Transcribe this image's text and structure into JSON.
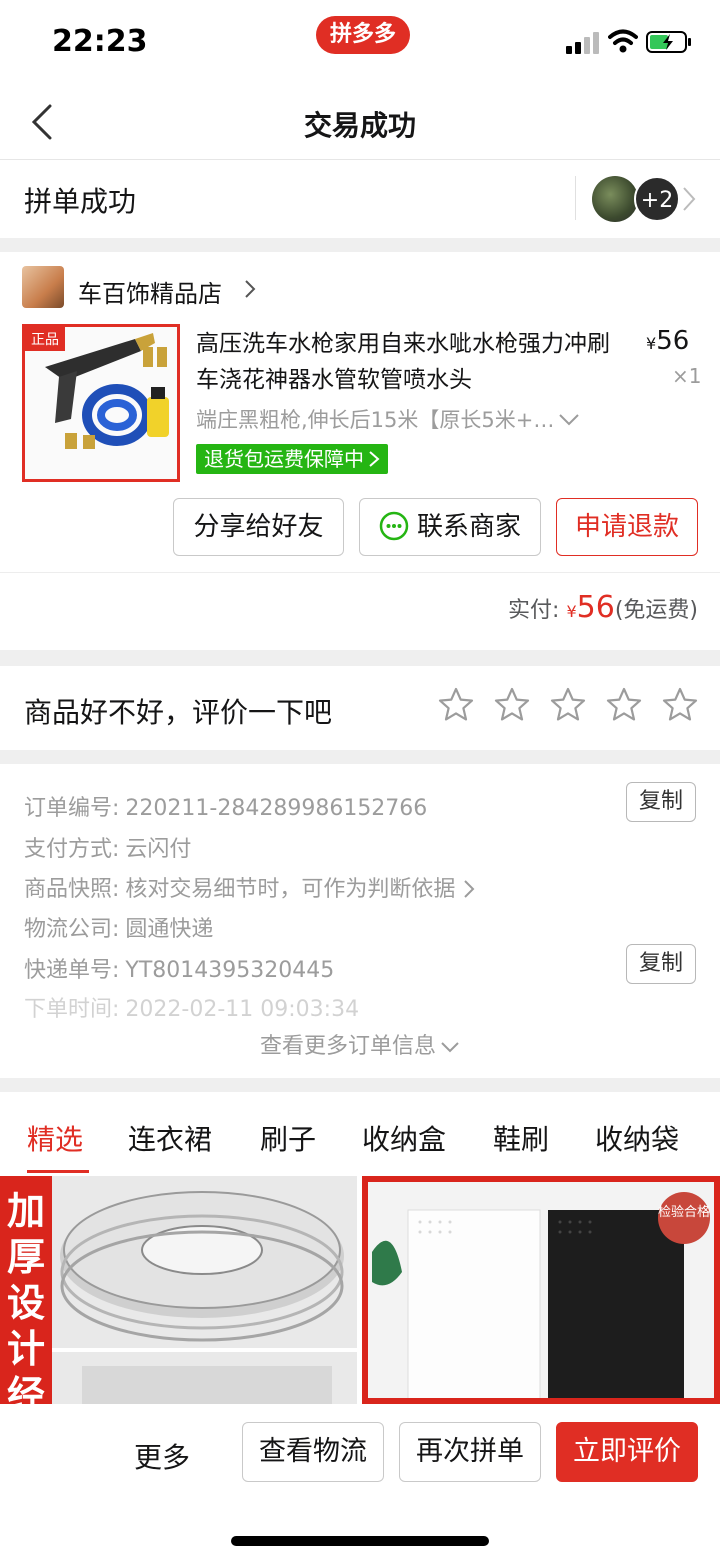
{
  "status_bar": {
    "time": "22:23",
    "brand_badge": "拼多多"
  },
  "nav": {
    "title": "交易成功"
  },
  "group": {
    "label": "拼单成功",
    "extra_count": "+2"
  },
  "shop": {
    "name": "车百饰精品店"
  },
  "product": {
    "thumb_tag": "正品",
    "title": "高压洗车水枪家用自来水呲水枪强力冲刷车浇花神器水管软管喷水头",
    "currency": "¥",
    "price": "56",
    "quantity": "×1",
    "spec": "端庄黑粗枪,伸长后15米【原长5米+…",
    "badge": "退货包运费保障中"
  },
  "actions": {
    "share": "分享给好友",
    "contact": "联系商家",
    "refund": "申请退款"
  },
  "payment": {
    "label": "实付:",
    "currency": "¥",
    "amount": "56",
    "note": "(免运费)"
  },
  "rating": {
    "prompt": "商品好不好，评价一下吧",
    "stars": 5,
    "filled": 0
  },
  "order_info": {
    "rows": [
      {
        "label": "订单编号:",
        "value": "220211-284289986152766",
        "copy": "复制"
      },
      {
        "label": "支付方式:",
        "value": "云闪付"
      },
      {
        "label": "商品快照:",
        "value": "核对交易细节时，可作为判断依据"
      },
      {
        "label": "物流公司:",
        "value": "圆通快递"
      },
      {
        "label": "快递单号:",
        "value": "YT8014395320445",
        "copy": "复制"
      },
      {
        "label": "下单时间:",
        "value": "2022-02-11 09:03:34"
      }
    ],
    "more": "查看更多订单信息"
  },
  "tabs": [
    "精选",
    "连衣裙",
    "刷子",
    "收纳盒",
    "鞋刷",
    "收纳袋"
  ],
  "feed": {
    "left_banner": "加厚设计经",
    "right_stamp": "检验合格"
  },
  "bottom_bar": {
    "more": "更多",
    "track": "查看物流",
    "again": "再次拼单",
    "review": "立即评价"
  },
  "colors": {
    "accent": "#e02e24",
    "green": "#25b513",
    "text": "#151516",
    "muted": "#9c9c9c"
  }
}
